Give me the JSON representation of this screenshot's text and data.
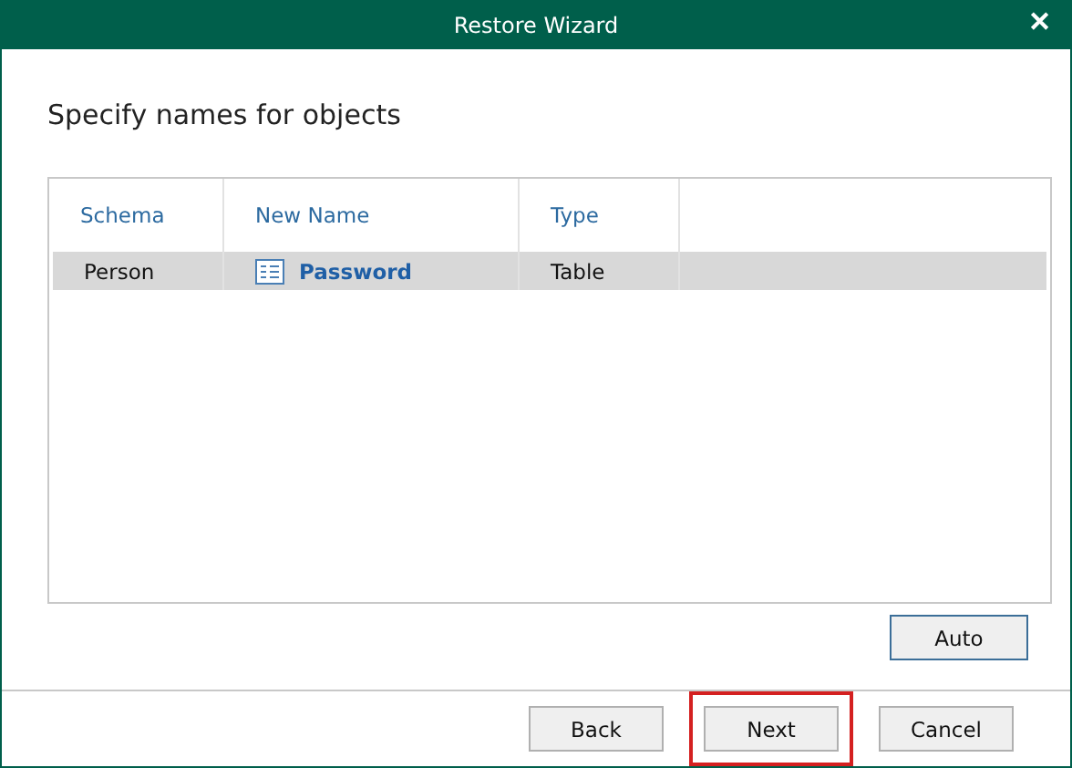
{
  "window": {
    "title": "Restore Wizard",
    "close": "✕"
  },
  "heading": "Specify names for objects",
  "table": {
    "columns": [
      "Schema",
      "New Name",
      "Type"
    ],
    "rows": [
      {
        "schema": "Person",
        "new_name": "Password",
        "type": "Table",
        "selected": true
      }
    ]
  },
  "auto_button": {
    "label": "Auto"
  },
  "buttons": [
    {
      "label": "Back",
      "highlighted": false
    },
    {
      "label": "Next",
      "highlighted": true
    },
    {
      "label": "Cancel",
      "highlighted": false
    }
  ]
}
